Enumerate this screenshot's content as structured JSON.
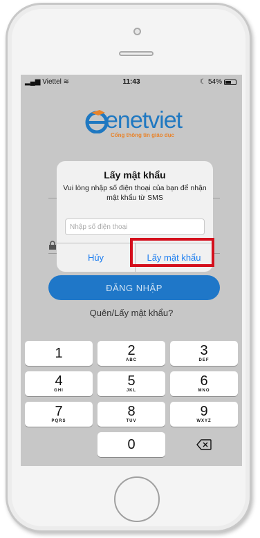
{
  "status_bar": {
    "carrier": "Viettel",
    "time": "11:43",
    "battery": "54%"
  },
  "app": {
    "logo_text": "enetviet",
    "logo_tagline": "Cổng thông tin giáo dục"
  },
  "login": {
    "login_button": "ĐĂNG NHẬP",
    "forgot_link": "Quên/Lấy mật khẩu?"
  },
  "dialog": {
    "title": "Lấy mật khẩu",
    "message": "Vui lòng nhập số điện thoại của bạn để nhận mật khẩu từ SMS",
    "phone_placeholder": "Nhập số điện thoại",
    "cancel_label": "Hủy",
    "confirm_label": "Lấy mật khẩu"
  },
  "keypad": {
    "keys": [
      {
        "num": "1",
        "letters": ""
      },
      {
        "num": "2",
        "letters": "ABC"
      },
      {
        "num": "3",
        "letters": "DEF"
      },
      {
        "num": "4",
        "letters": "GHI"
      },
      {
        "num": "5",
        "letters": "JKL"
      },
      {
        "num": "6",
        "letters": "MNO"
      },
      {
        "num": "7",
        "letters": "PQRS"
      },
      {
        "num": "8",
        "letters": "TUV"
      },
      {
        "num": "9",
        "letters": "WXYZ"
      },
      {
        "num": "0",
        "letters": ""
      }
    ],
    "backspace_icon": "backspace-icon"
  },
  "colors": {
    "brand_blue": "#1f77c8",
    "link_blue": "#1a7cf0",
    "highlight_red": "#d40f1c"
  }
}
